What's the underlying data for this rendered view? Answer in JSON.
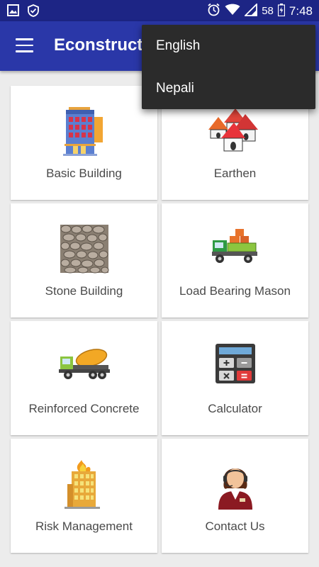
{
  "status_bar": {
    "battery": "58",
    "time": "7:48",
    "icons": [
      "image-icon",
      "shield-icon",
      "alarm-icon",
      "wifi-icon",
      "signal-icon",
      "battery-icon"
    ]
  },
  "app_bar": {
    "title": "Econstruction",
    "menu_icon": "hamburger-menu-icon"
  },
  "dropdown": {
    "items": [
      "English",
      "Nepali"
    ]
  },
  "grid": {
    "items": [
      {
        "label": "Basic Building",
        "icon": "building-icon"
      },
      {
        "label": "Earthen",
        "icon": "huts-icon"
      },
      {
        "label": "Stone Building",
        "icon": "stone-wall-icon"
      },
      {
        "label": "Load Bearing Mason",
        "icon": "truck-bricks-icon"
      },
      {
        "label": "Reinforced Concrete",
        "icon": "concrete-mixer-icon"
      },
      {
        "label": "Calculator",
        "icon": "calculator-icon"
      },
      {
        "label": "Risk Management",
        "icon": "burning-building-icon"
      },
      {
        "label": "Contact Us",
        "icon": "support-agent-icon"
      }
    ]
  },
  "colors": {
    "status_bar": "#1d2585",
    "app_bar": "#2a37a8",
    "background": "#ececec",
    "menu_bg": "#2b2b2b"
  }
}
